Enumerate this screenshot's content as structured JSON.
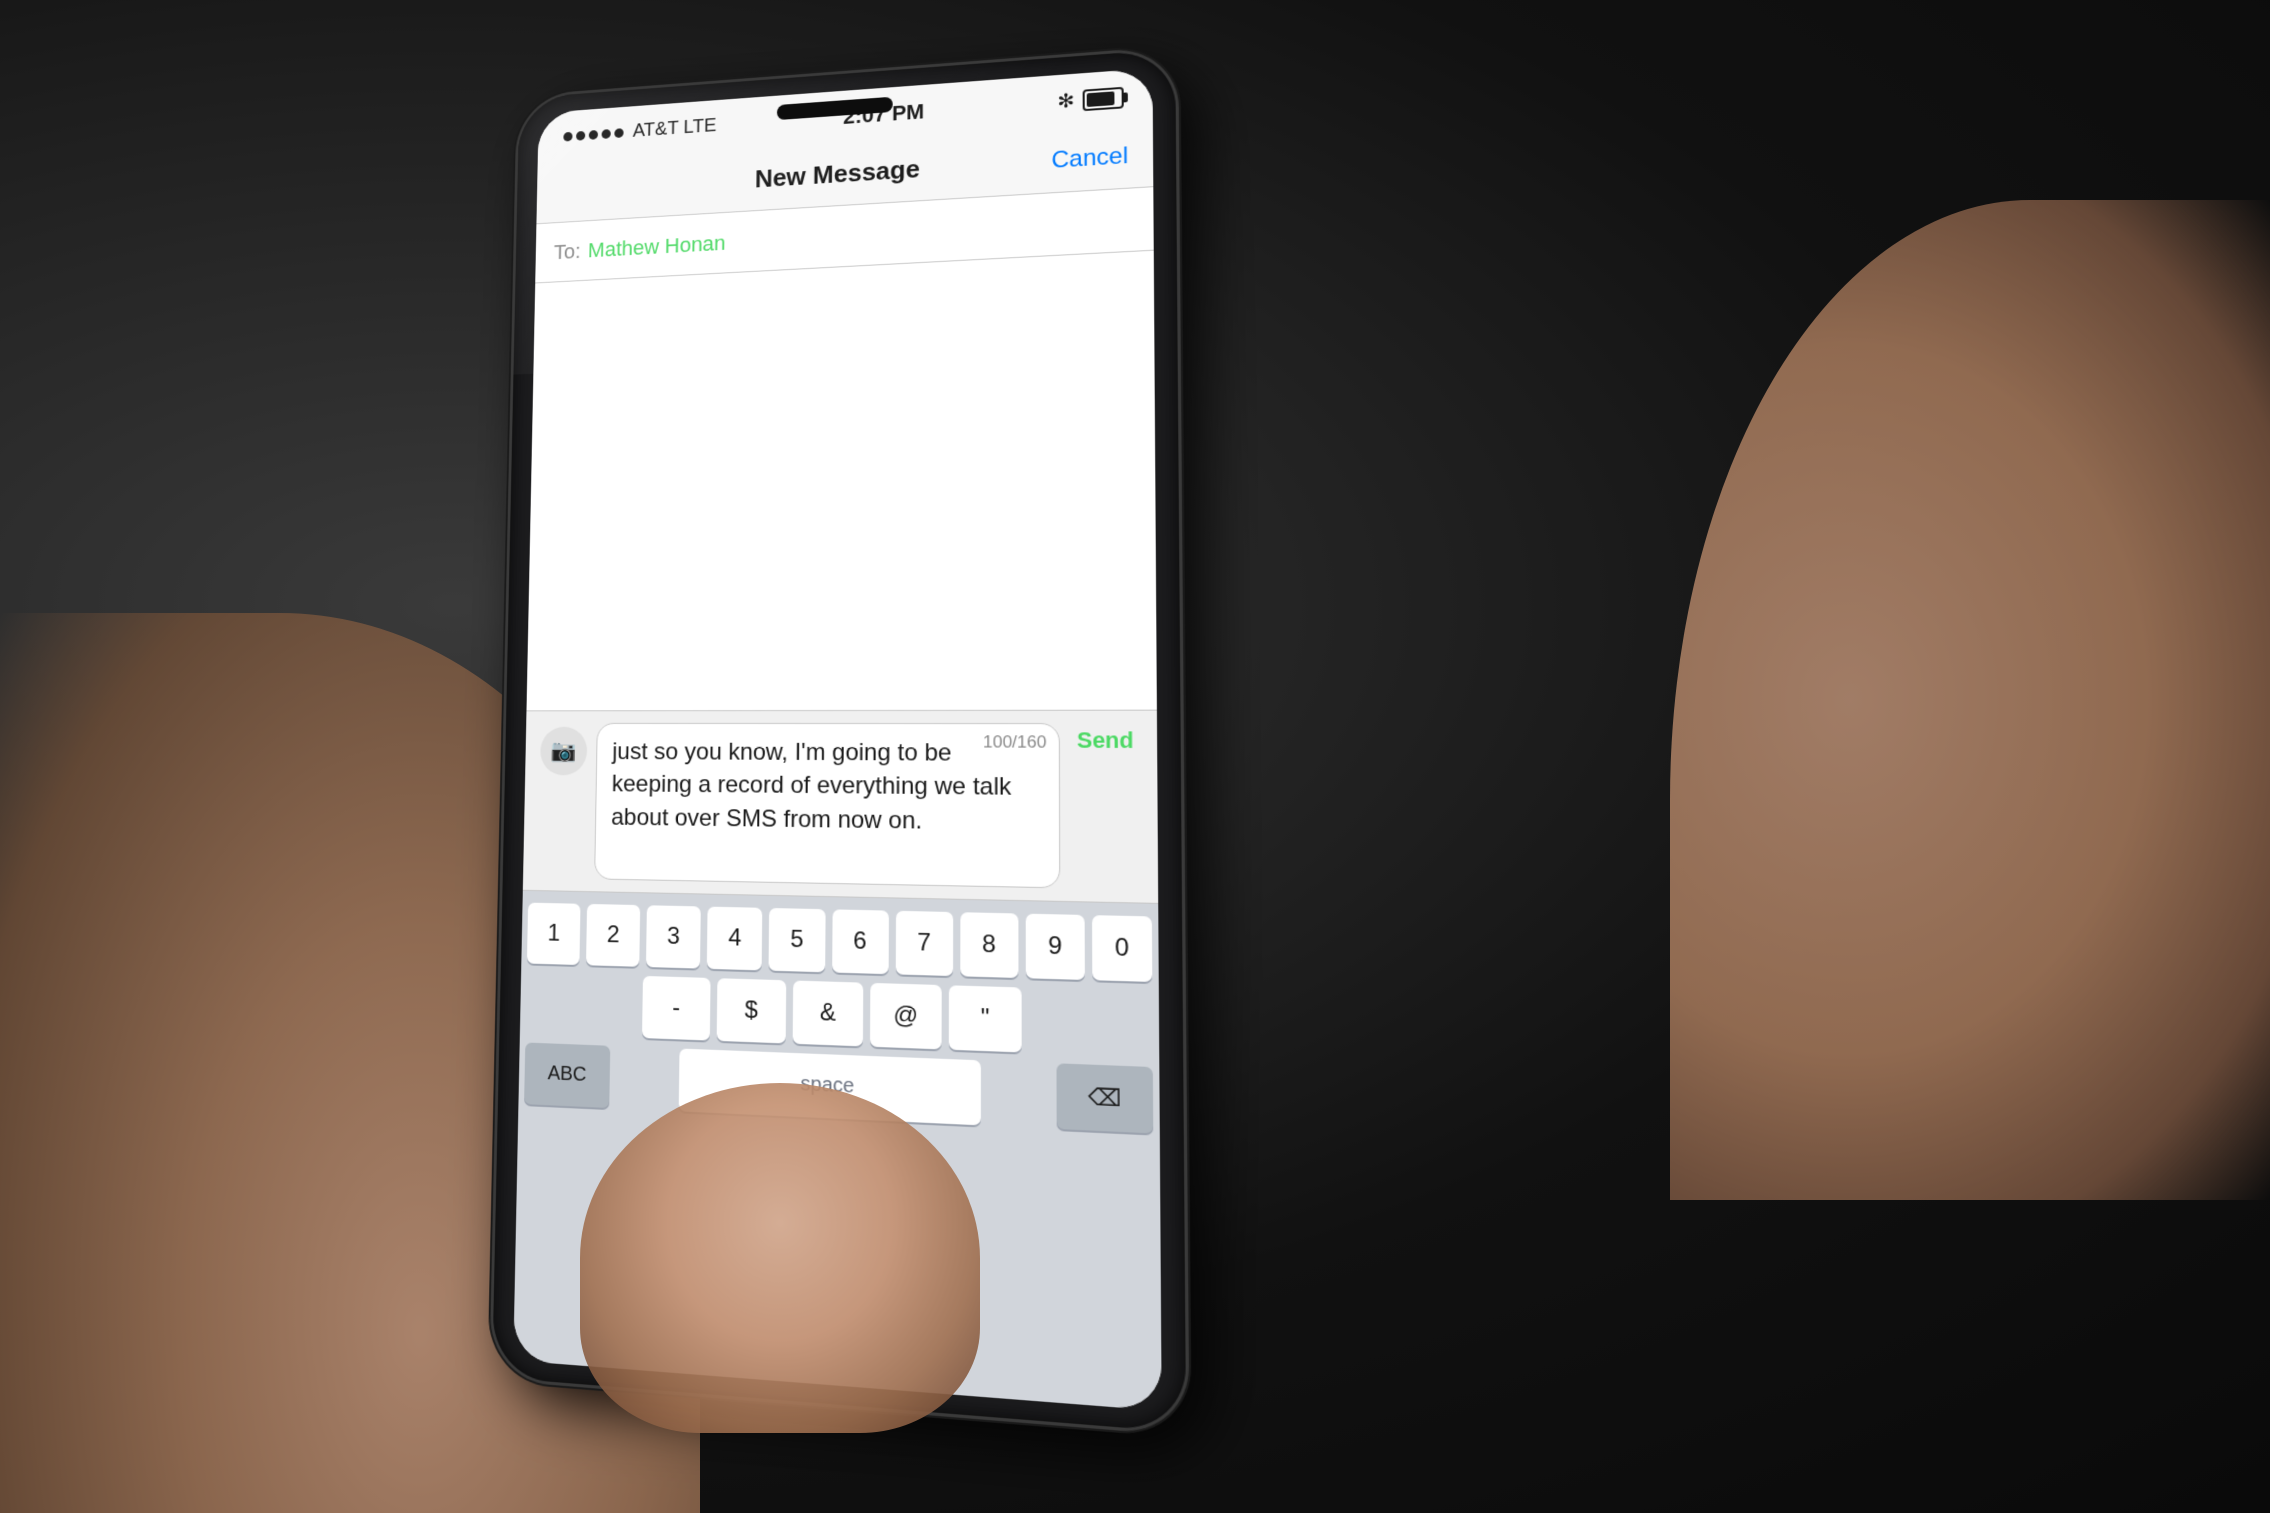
{
  "background": {
    "color": "#1a1a1a"
  },
  "phone": {
    "status_bar": {
      "signal_dots": 5,
      "carrier": "AT&T LTE",
      "time": "2:07 PM",
      "bluetooth": "✻",
      "battery_label": "Battery"
    },
    "nav": {
      "title": "New Message",
      "cancel_label": "Cancel"
    },
    "to_field": {
      "label": "To:",
      "contact": "Mathew Honan"
    },
    "compose": {
      "camera_icon": "📷",
      "message_text": "just so you know, I'm going to be keeping a record of everything we talk about over SMS from now on.",
      "char_count": "100/160",
      "send_label": "Send"
    },
    "keyboard": {
      "row1": [
        "1",
        "2",
        "3",
        "4",
        "5",
        "6",
        "7",
        "8",
        "9",
        "0"
      ],
      "row2": [
        "-",
        "$",
        "&",
        "@",
        "\""
      ],
      "abc_label": "ABC",
      "delete_icon": "⌫",
      "colors": {
        "key_bg": "#ffffff",
        "keyboard_bg": "#d1d5db",
        "gray_key": "#adb5bd"
      }
    }
  }
}
